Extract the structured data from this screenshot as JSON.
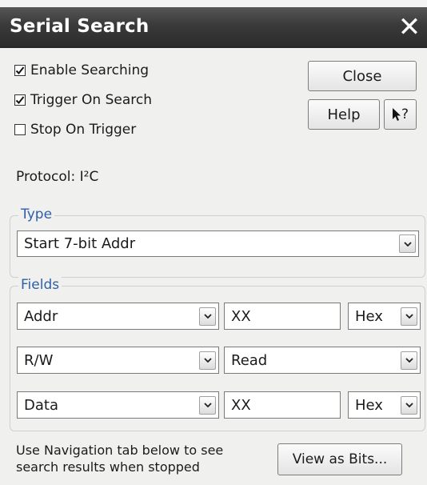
{
  "window": {
    "title": "Serial Search",
    "close_glyph": "✕"
  },
  "options": {
    "enable_searching": {
      "label": "Enable Searching",
      "checked": true
    },
    "trigger_on_search": {
      "label": "Trigger On Search",
      "checked": true
    },
    "stop_on_trigger": {
      "label": "Stop On Trigger",
      "checked": false
    }
  },
  "buttons": {
    "close": "Close",
    "help": "Help",
    "context_help": "?",
    "view_as_bits": "View as Bits..."
  },
  "protocol": {
    "text": "Protocol: I²C"
  },
  "type_group": {
    "legend": "Type",
    "value": "Start 7-bit Addr"
  },
  "fields_group": {
    "legend": "Fields",
    "rows": [
      {
        "field": "Addr",
        "value": "XX",
        "format": "Hex"
      },
      {
        "field": "R/W",
        "value": "Read"
      },
      {
        "field": "Data",
        "value": "XX",
        "format": "Hex"
      }
    ]
  },
  "footer": {
    "line1": "Use Navigation tab below to see",
    "line2": "search results when stopped"
  },
  "icons": {
    "dropdown": "chevron-down-icon",
    "checkmark": "checkmark-icon",
    "pointer": "pointer-arrow-icon"
  }
}
